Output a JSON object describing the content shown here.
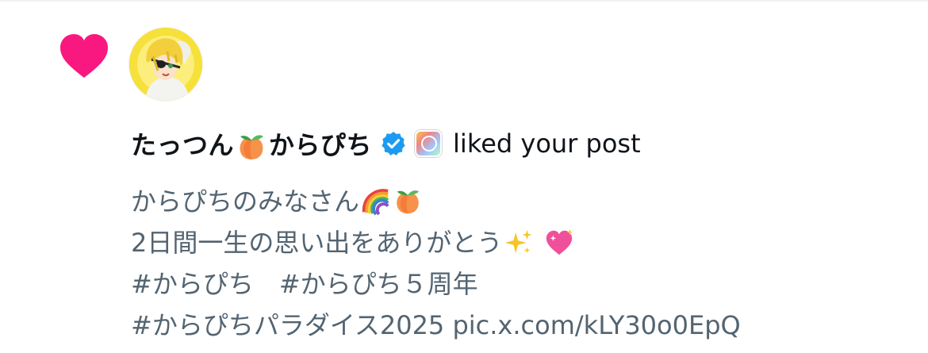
{
  "notification": {
    "user_name_part1": "たっつん",
    "user_name_part2": "からぴち",
    "action_text": "liked your post"
  },
  "post": {
    "line1": "からぴちのみなさん",
    "line2": "2日間一生の思い出をありがとう",
    "line3": "#からぴち　#からぴち５周年",
    "line4": "#からぴちパラダイス2025 pic.x.com/kLY30o0EpQ"
  },
  "icons": {
    "like": "heart-icon",
    "verified": "verified-badge-icon",
    "affiliate": "affiliate-badge-icon",
    "emoji_peach": "peach-emoji",
    "emoji_rainbow": "rainbow-emoji",
    "emoji_sparkles": "sparkles-emoji",
    "emoji_sparkling_heart": "sparkling-heart-emoji"
  },
  "colors": {
    "like_pink": "#f91880",
    "verified_blue": "#1d9bf0",
    "primary_text": "#0f1419",
    "secondary_text": "#536471"
  }
}
